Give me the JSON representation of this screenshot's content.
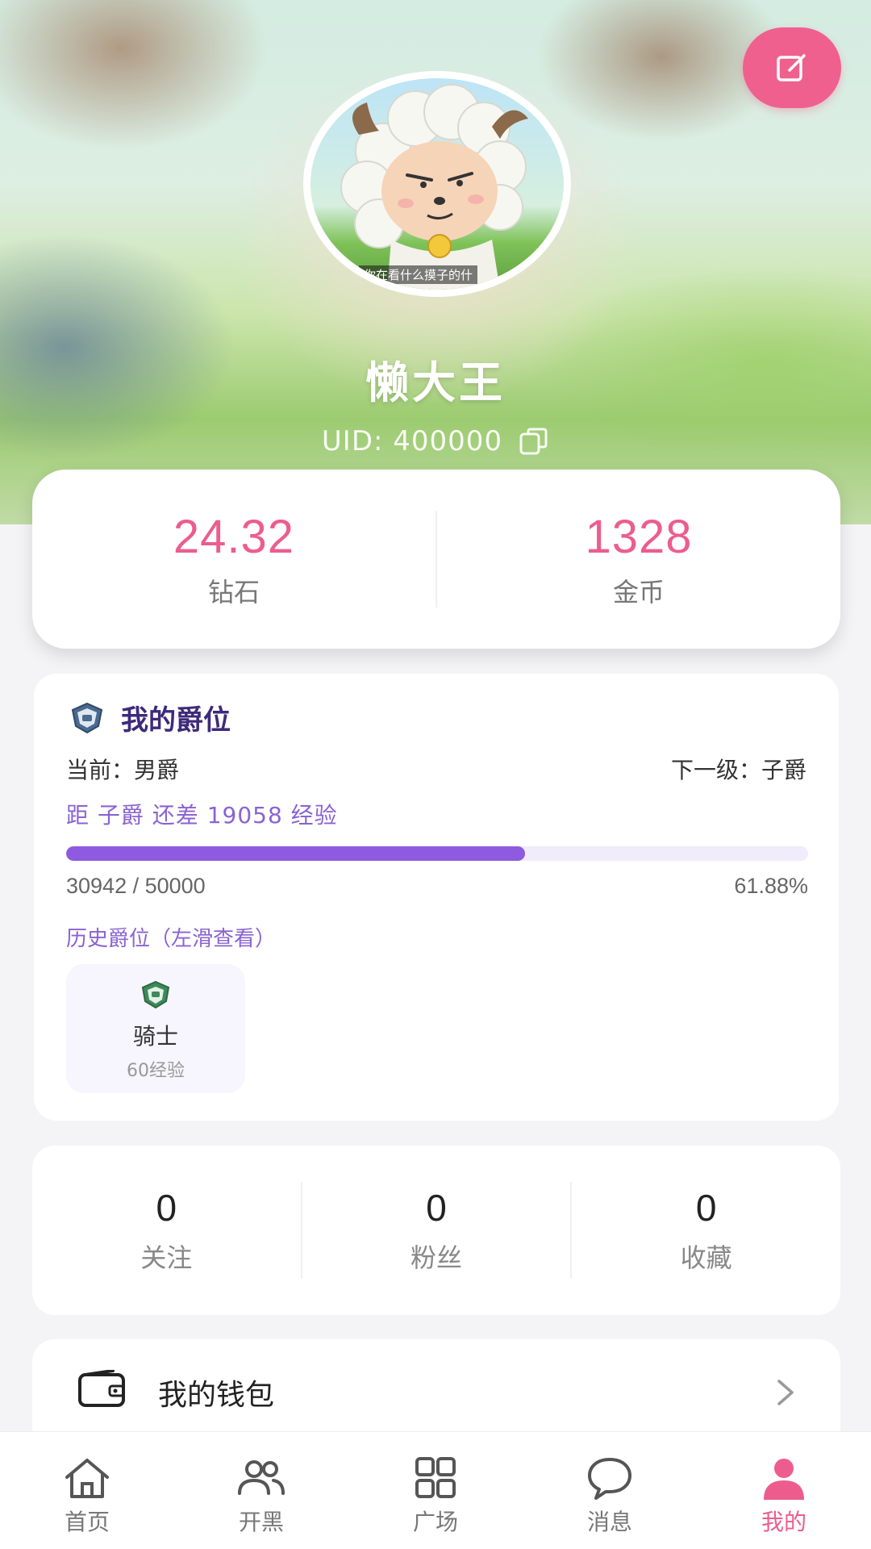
{
  "profile": {
    "username": "懒大王",
    "uid_text": "UID: 400000",
    "avatar_caption": "你在看什么摸子的什"
  },
  "balance": {
    "diamond_value": "24.32",
    "diamond_label": "钻石",
    "coin_value": "1328",
    "coin_label": "金币"
  },
  "rank": {
    "title": "我的爵位",
    "current": "当前：男爵",
    "next": "下一级：子爵",
    "gap_text": "距 子爵 还差 19058 经验",
    "progress_fraction": 0.6188,
    "progress_count": "30942 / 50000",
    "progress_percent": "61.88%",
    "history_label": "历史爵位（左滑查看）",
    "history": [
      {
        "name": "骑士",
        "exp": "60经验"
      }
    ]
  },
  "social": {
    "following_value": "0",
    "following_label": "关注",
    "fans_value": "0",
    "fans_label": "粉丝",
    "favorites_value": "0",
    "favorites_label": "收藏"
  },
  "wallet": {
    "label": "我的钱包"
  },
  "nav": {
    "items": [
      {
        "label": "首页",
        "icon": "home-icon"
      },
      {
        "label": "开黑",
        "icon": "group-icon"
      },
      {
        "label": "广场",
        "icon": "grid-icon"
      },
      {
        "label": "消息",
        "icon": "chat-icon"
      },
      {
        "label": "我的",
        "icon": "person-icon"
      }
    ],
    "active_index": 4
  },
  "colors": {
    "accent_pink": "#ec5d8d",
    "accent_purple": "#8e5ae0",
    "title_purple": "#3d2a7a"
  }
}
